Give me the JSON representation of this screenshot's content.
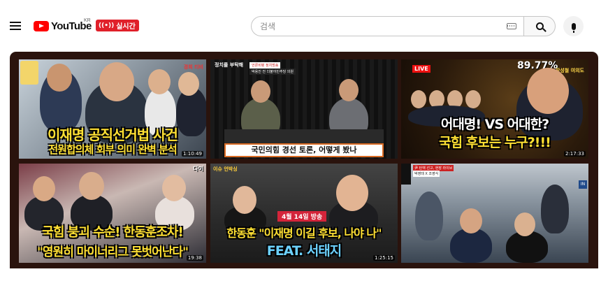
{
  "header": {
    "logo_text": "YouTube",
    "region": "KR",
    "live_badge": "실시간",
    "search_placeholder": "검색"
  },
  "thumbnails": [
    {
      "line1": "이재명 공직선거법 사건",
      "line2": "전원합의체 회부 의미 완벽 분석",
      "corner": "경희 티비",
      "duration": "1:10:49"
    },
    {
      "channel": "정치를 부탁해",
      "topbar": "언론비평 정치방송",
      "topbar2": "박용진 전 더불어민주당 의원",
      "ribbon": "국민의힘 경선 토론, 어떻게 봤나",
      "duration": ""
    },
    {
      "live": "LIVE",
      "percent": "89.77%",
      "corner": "장성철 여의도",
      "line1": "어대명! VS 어대한?",
      "line2": "국힘 후보는 누구?!!!",
      "duration": "2:17:33"
    },
    {
      "logo": "다이",
      "line1": "국힘 붕괴 수순! 한동훈조차!",
      "line2": "\"영원히 마이너리그 못벗어난다\"",
      "duration": "19:38"
    },
    {
      "topl": "이슈 언박싱",
      "tag": "4월 14일 방송",
      "line1": "한동훈 \"이재명 이길 후보, 나야 나\"",
      "line2": "FEAT. 서태지",
      "duration": "1:25:15"
    },
    {
      "bar": "尹 탄핵 선고, 현장 라이브",
      "bar2": "박영태 X 조영식",
      "sq": "IN",
      "duration": ""
    }
  ]
}
